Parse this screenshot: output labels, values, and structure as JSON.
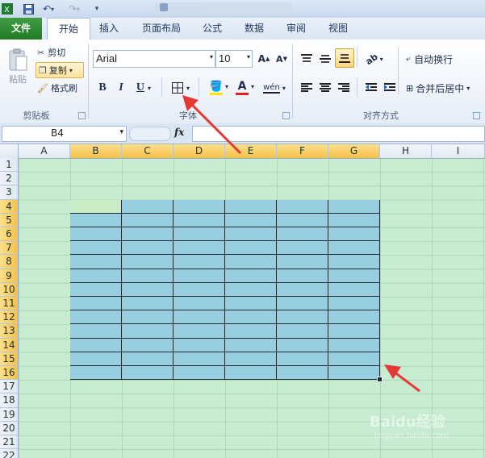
{
  "quick_access": {
    "save": "save-icon",
    "undo": "undo-icon",
    "redo": "redo-icon"
  },
  "tabs": [
    {
      "label": "文件"
    },
    {
      "label": "开始"
    },
    {
      "label": "插入"
    },
    {
      "label": "页面布局"
    },
    {
      "label": "公式"
    },
    {
      "label": "数据"
    },
    {
      "label": "审阅"
    },
    {
      "label": "视图"
    }
  ],
  "clipboard": {
    "paste": "粘贴",
    "cut": "剪切",
    "copy": "复制",
    "format_painter": "格式刷",
    "group": "剪贴板"
  },
  "font": {
    "name": "Arial",
    "size": "10",
    "bold": "B",
    "italic": "I",
    "underline": "U",
    "font_color_letter": "A",
    "wen": "wén",
    "group": "字体"
  },
  "alignment": {
    "wrap_text": "自动换行",
    "merge_center": "合并后居中",
    "group": "对齐方式"
  },
  "formula_bar": {
    "name_box": "B4",
    "fx": "fx",
    "formula": ""
  },
  "columns": [
    "A",
    "B",
    "C",
    "D",
    "E",
    "F",
    "G",
    "H",
    "I"
  ],
  "rows": [
    "1",
    "2",
    "3",
    "4",
    "5",
    "6",
    "7",
    "8",
    "9",
    "10",
    "11",
    "12",
    "13",
    "14",
    "15",
    "16",
    "17",
    "18",
    "19",
    "20",
    "21",
    "22"
  ],
  "selection": {
    "range": "B4:G16",
    "active_cell": "B4"
  },
  "colors": {
    "table_fill": "#97cfe1",
    "sheet_bg": "#c8ecd1",
    "active_cell": "#c9ecc6",
    "arrow": "#e53935",
    "file_tab": "#2a8a2e"
  },
  "watermark": {
    "brand": "Baidu经验",
    "url": "jingyan.baidu.com"
  }
}
